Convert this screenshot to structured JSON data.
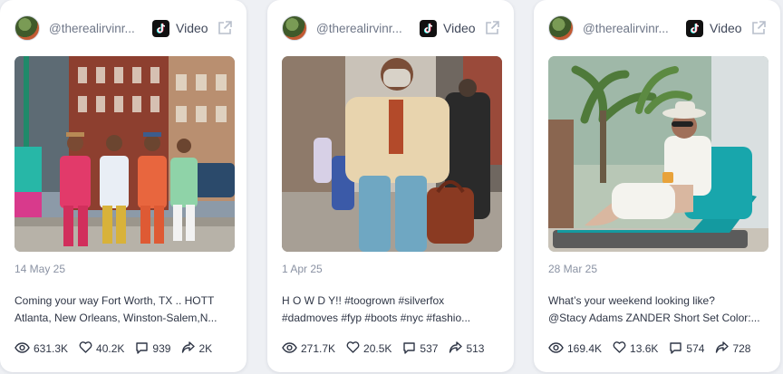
{
  "colors": {
    "background": "#eef0f4",
    "card": "#ffffff",
    "text": "#2f3646",
    "muted": "#8a92a3"
  },
  "icons": {
    "views": "eye-icon",
    "likes": "heart-icon",
    "comments": "comment-icon",
    "shares": "share-icon",
    "external": "external-link-icon",
    "platform": "tiktok-icon"
  },
  "posts": [
    {
      "handle": "@therealirvinr...",
      "platform": "Video",
      "date": "14 May 25",
      "caption_line1": "Coming your way Fort Worth, TX .. HOTT",
      "caption_line2": "Atlanta, New Orleans, Winston-Salem,N...",
      "views": "631.3K",
      "likes": "40.2K",
      "comments": "939",
      "shares": "2K"
    },
    {
      "handle": "@therealirvinr...",
      "platform": "Video",
      "date": "1 Apr 25",
      "caption_line1": "H O W D Y!! #toogrown #silverfox",
      "caption_line2": "#dadmoves #fyp #boots #nyc #fashio...",
      "views": "271.7K",
      "likes": "20.5K",
      "comments": "537",
      "shares": "513"
    },
    {
      "handle": "@therealirvinr...",
      "platform": "Video",
      "date": "28 Mar 25",
      "caption_line1": "What’s your weekend looking like?",
      "caption_line2": "@Stacy Adams ZANDER Short Set Color:...",
      "views": "169.4K",
      "likes": "13.6K",
      "comments": "574",
      "shares": "728"
    }
  ]
}
